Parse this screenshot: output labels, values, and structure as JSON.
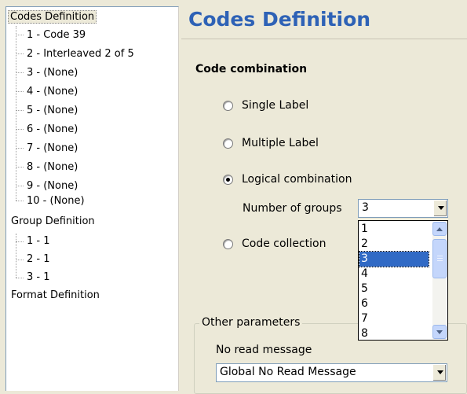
{
  "tree": {
    "codes_definition": "Codes Definition",
    "codes": [
      "1 - Code 39",
      "2 - Interleaved 2 of 5",
      "3 - (None)",
      "4 - (None)",
      "5 - (None)",
      "6 - (None)",
      "7 - (None)",
      "8 - (None)",
      "9 - (None)",
      "10 - (None)"
    ],
    "group_definition": "Group Definition",
    "groups": [
      "1 - 1",
      "2 - 1",
      "3 - 1"
    ],
    "format_definition": "Format Definition"
  },
  "page": {
    "title": "Codes Definition",
    "section_title": "Code combination"
  },
  "radios": {
    "single_label": "Single Label",
    "multiple_label": "Multiple Label",
    "logical_combination": "Logical combination",
    "code_collection": "Code collection",
    "selected": "logical_combination"
  },
  "groups_field": {
    "label": "Number of groups",
    "value": "3",
    "options": [
      "1",
      "2",
      "3",
      "4",
      "5",
      "6",
      "7",
      "8"
    ],
    "highlighted": "3"
  },
  "other_parameters": {
    "title": "Other parameters",
    "no_read_label": "No read message",
    "no_read_value": "Global No Read Message"
  },
  "colors": {
    "heading": "#2e62b6",
    "selection": "#316ac5",
    "window_bg": "#ece9d8"
  }
}
